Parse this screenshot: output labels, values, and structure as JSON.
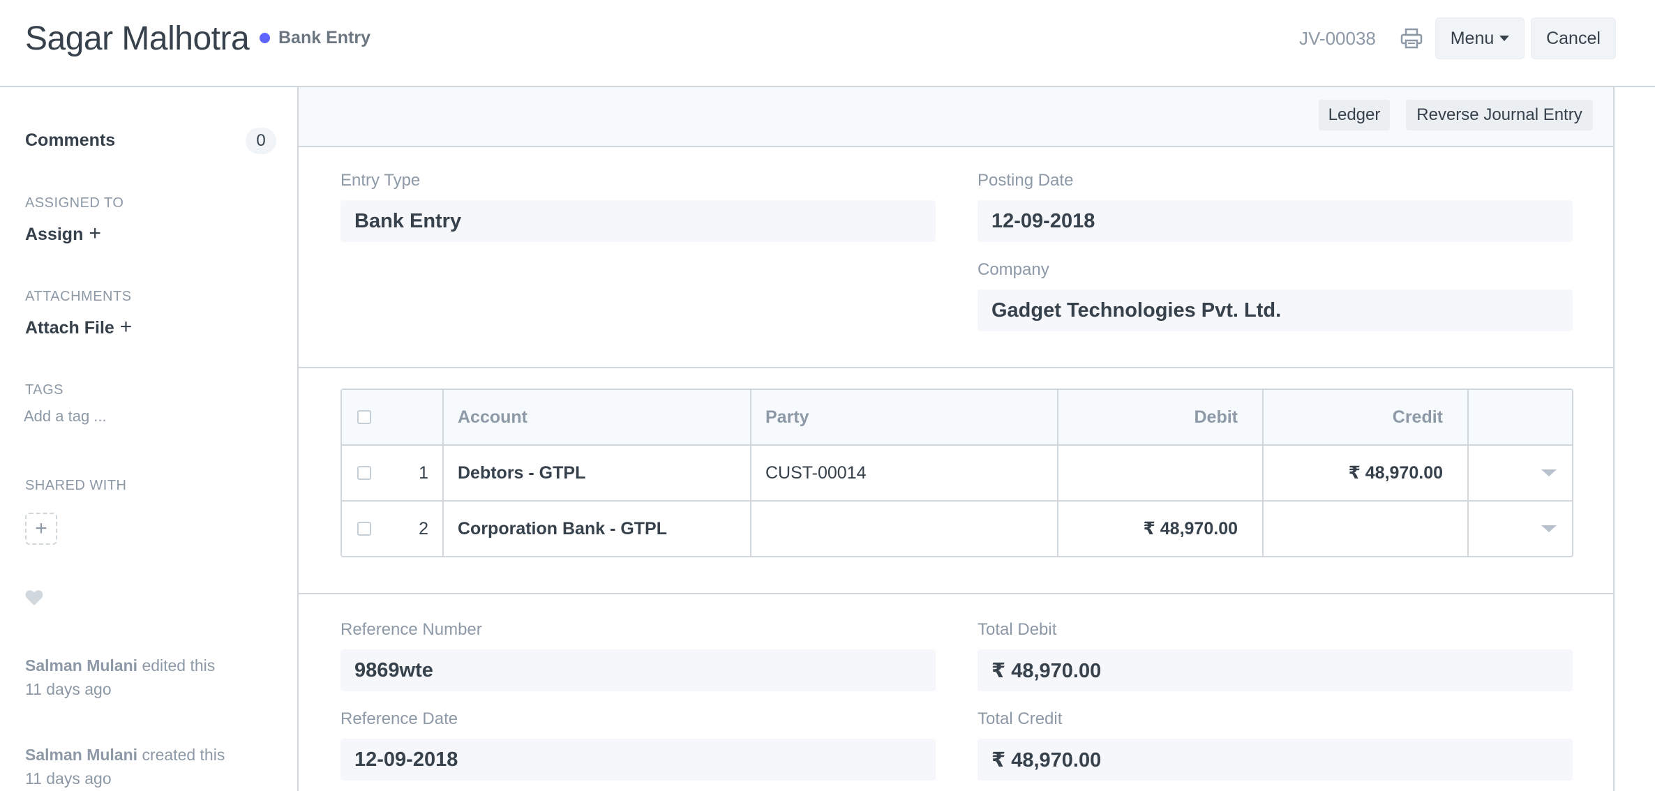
{
  "header": {
    "title": "Sagar Malhotra",
    "status": "Bank Entry",
    "status_color": "#5e64ff",
    "doc_id": "JV-00038",
    "print_icon": "printer-icon",
    "menu_label": "Menu",
    "cancel_label": "Cancel"
  },
  "sidebar": {
    "comments_label": "Comments",
    "comments_count": "0",
    "assigned_to_label": "ASSIGNED TO",
    "assign_label": "Assign",
    "attachments_label": "ATTACHMENTS",
    "attach_label": "Attach File",
    "tags_label": "TAGS",
    "tag_placeholder": "Add a tag ...",
    "shared_with_label": "SHARED WITH",
    "plus": "+",
    "activity": [
      {
        "user": "Salman Mulani",
        "action": "edited this",
        "time": "11 days ago"
      },
      {
        "user": "Salman Mulani",
        "action": "created this",
        "time": "11 days ago"
      }
    ]
  },
  "toolbar": {
    "ledger_label": "Ledger",
    "reverse_label": "Reverse Journal Entry"
  },
  "form": {
    "entry_type_label": "Entry Type",
    "entry_type_value": "Bank Entry",
    "posting_date_label": "Posting Date",
    "posting_date_value": "12-09-2018",
    "company_label": "Company",
    "company_value": "Gadget Technologies Pvt. Ltd.",
    "reference_number_label": "Reference Number",
    "reference_number_value": "9869wte",
    "reference_date_label": "Reference Date",
    "reference_date_value": "12-09-2018",
    "total_debit_label": "Total Debit",
    "total_debit_value": "₹ 48,970.00",
    "total_credit_label": "Total Credit",
    "total_credit_value": "₹ 48,970.00"
  },
  "grid": {
    "columns": [
      "Account",
      "Party",
      "Debit",
      "Credit"
    ],
    "rows": [
      {
        "idx": "1",
        "account": "Debtors - GTPL",
        "party": "CUST-00014",
        "debit": "",
        "credit": "₹ 48,970.00"
      },
      {
        "idx": "2",
        "account": "Corporation Bank - GTPL",
        "party": "",
        "debit": "₹ 48,970.00",
        "credit": ""
      }
    ]
  }
}
